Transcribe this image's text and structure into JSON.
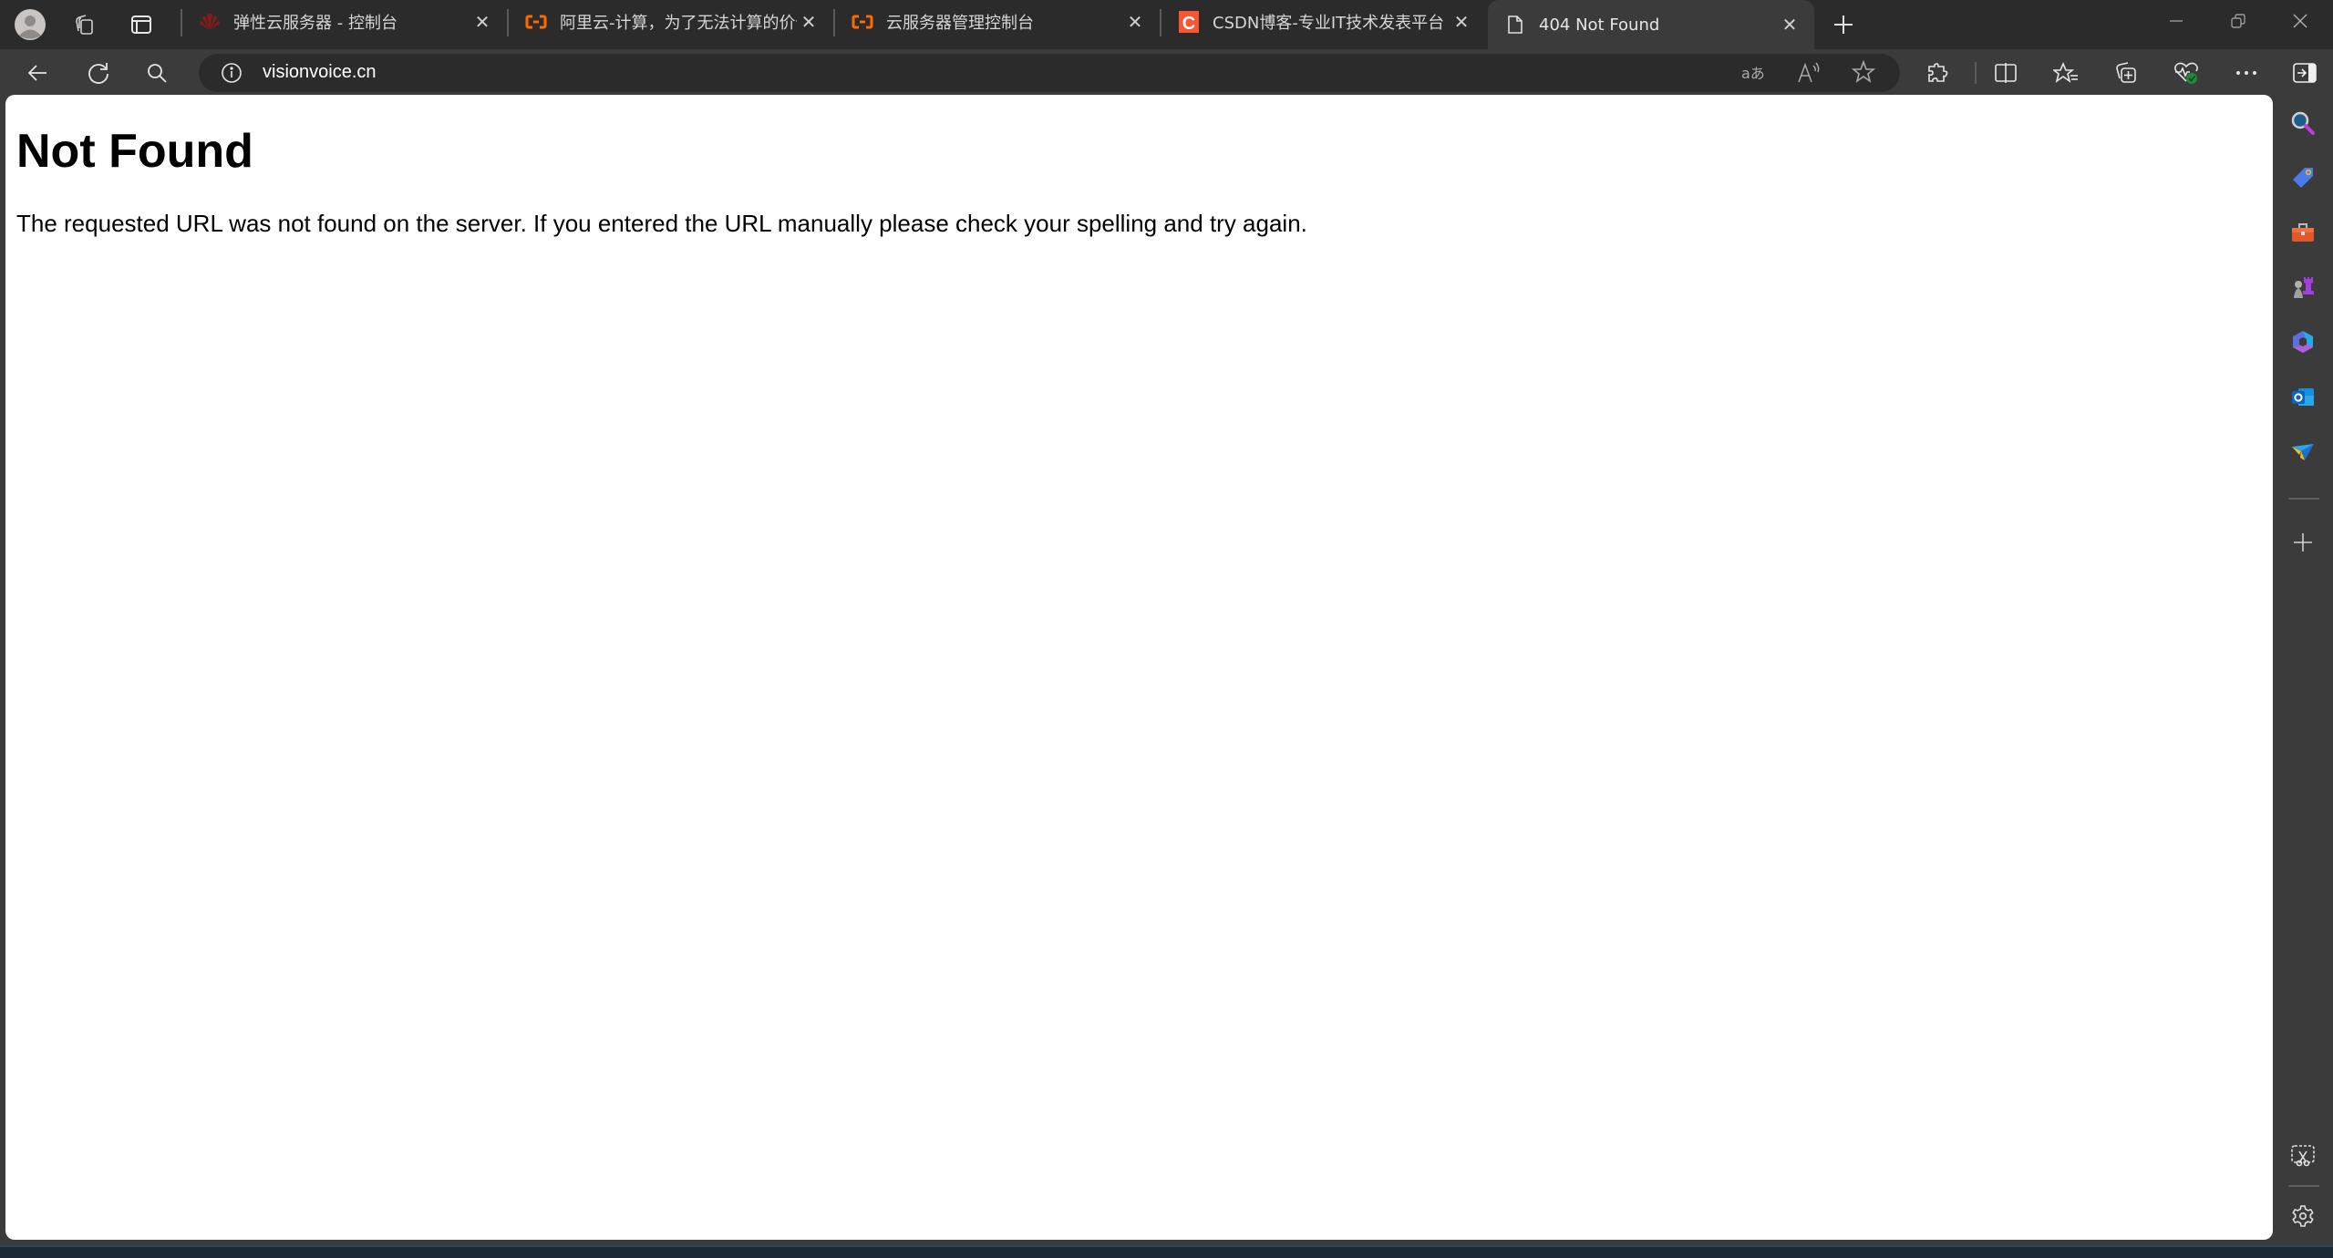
{
  "browser": {
    "tabs": [
      {
        "title": "弹性云服务器 - 控制台",
        "favicon": "huawei-cloud-icon",
        "active": false
      },
      {
        "title": "阿里云-计算，为了无法计算的价值",
        "favicon": "aliyun-icon",
        "active": false
      },
      {
        "title": "云服务器管理控制台",
        "favicon": "aliyun-icon",
        "active": false
      },
      {
        "title": "CSDN博客-专业IT技术发表平台",
        "favicon": "csdn-icon",
        "active": false
      },
      {
        "title": "404 Not Found",
        "favicon": "page-icon",
        "active": true
      }
    ],
    "close_glyph": "✕",
    "new_tab_glyph": "+",
    "address_bar": {
      "url": "visionvoice.cn",
      "site_info_icon": "info-icon"
    },
    "toolbar_icons": [
      "back-icon",
      "refresh-icon",
      "search-icon",
      "translate-icon",
      "read-aloud-icon",
      "favorite-star-icon",
      "extensions-icon",
      "split-screen-icon",
      "favorites-icon",
      "collections-icon",
      "browser-essentials-icon",
      "more-icon",
      "sidebar-toggle-icon"
    ],
    "window_controls": [
      "minimize",
      "restore",
      "close"
    ],
    "sidebar_icons": [
      "search",
      "shopping",
      "tools",
      "games",
      "microsoft-365",
      "outlook",
      "drop",
      "add",
      "screenshot",
      "settings"
    ],
    "accent_colors": {
      "aliyun": "#ff6a00",
      "csdn": "#fc5531",
      "essentials_ok": "#1e8a3a"
    }
  },
  "page": {
    "heading": "Not Found",
    "message": "The requested URL was not found on the server. If you entered the URL manually please check your spelling and try again."
  }
}
